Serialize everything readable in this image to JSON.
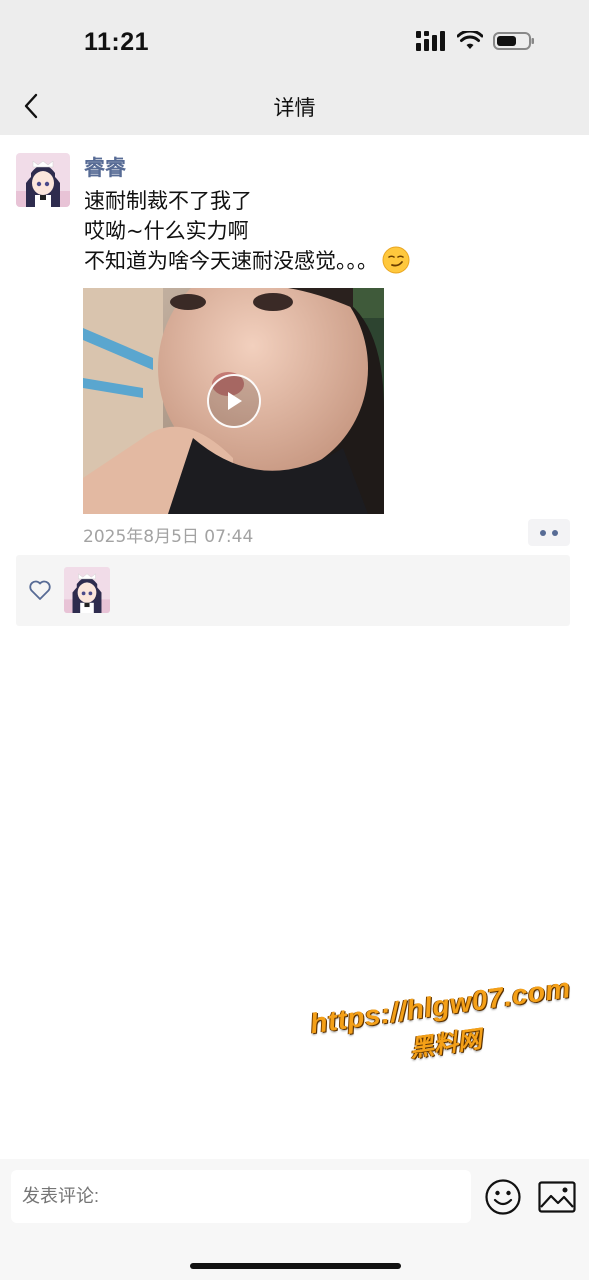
{
  "status_bar": {
    "time": "11:21",
    "icons": [
      "signal-icon",
      "wifi-icon",
      "battery-icon"
    ]
  },
  "nav": {
    "back_icon": "chevron-left-icon",
    "title": "详情"
  },
  "post": {
    "user_name": "睿睿",
    "text_lines": [
      "速耐制裁不了我了",
      "哎呦~什么实力啊",
      "不知道为啥今天速耐没感觉。。。"
    ],
    "emoji_icon": "smirk-emoji-icon",
    "media": {
      "type": "video",
      "play_icon": "play-icon"
    },
    "timestamp": "2025年8月5日 07:44",
    "more_icon": "more-dots-icon"
  },
  "likes": {
    "like_icon": "heart-outline-icon",
    "likers": [
      "avatar"
    ]
  },
  "watermark": {
    "url": "https://hlgw07.com",
    "name": "黑料网"
  },
  "comment_bar": {
    "placeholder": "发表评论:",
    "emoji_icon": "smiley-icon",
    "image_icon": "image-icon"
  },
  "colors": {
    "header_bg": "#ededed",
    "username": "#576b95",
    "timestamp": "#a3a3a3",
    "likes_bg": "#f5f5f5",
    "watermark": "#f4a018"
  }
}
